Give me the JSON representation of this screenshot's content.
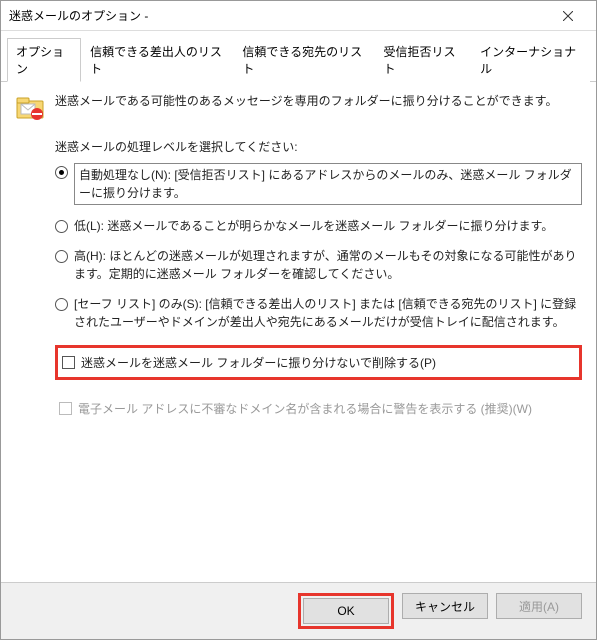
{
  "window": {
    "title": "迷惑メールのオプション -"
  },
  "tabs": {
    "t0": "オプション",
    "t1": "信頼できる差出人のリスト",
    "t2": "信頼できる宛先のリスト",
    "t3": "受信拒否リスト",
    "t4": "インターナショナル"
  },
  "intro": "迷惑メールである可能性のあるメッセージを専用のフォルダーに振り分けることができます。",
  "level_label": "迷惑メールの処理レベルを選択してください:",
  "radios": {
    "r0": "自動処理なし(N):  [受信拒否リスト] にあるアドレスからのメールのみ、迷惑メール フォルダーに振り分けます。",
    "r1": "低(L): 迷惑メールであることが明らかなメールを迷惑メール フォルダーに振り分けます。",
    "r2": "高(H): ほとんどの迷惑メールが処理されますが、通常のメールもその対象になる可能性があります。定期的に迷惑メール フォルダーを確認してください。",
    "r3": "[セーフ リスト] のみ(S): [信頼できる差出人のリスト] または [信頼できる宛先のリスト] に登録されたユーザーやドメインが差出人や宛先にあるメールだけが受信トレイに配信されます。"
  },
  "checks": {
    "c0": "迷惑メールを迷惑メール フォルダーに振り分けないで削除する(P)",
    "c1": "電子メール アドレスに不審なドメイン名が含まれる場合に警告を表示する (推奨)(W)"
  },
  "buttons": {
    "ok": "OK",
    "cancel": "キャンセル",
    "apply": "適用(A)"
  }
}
